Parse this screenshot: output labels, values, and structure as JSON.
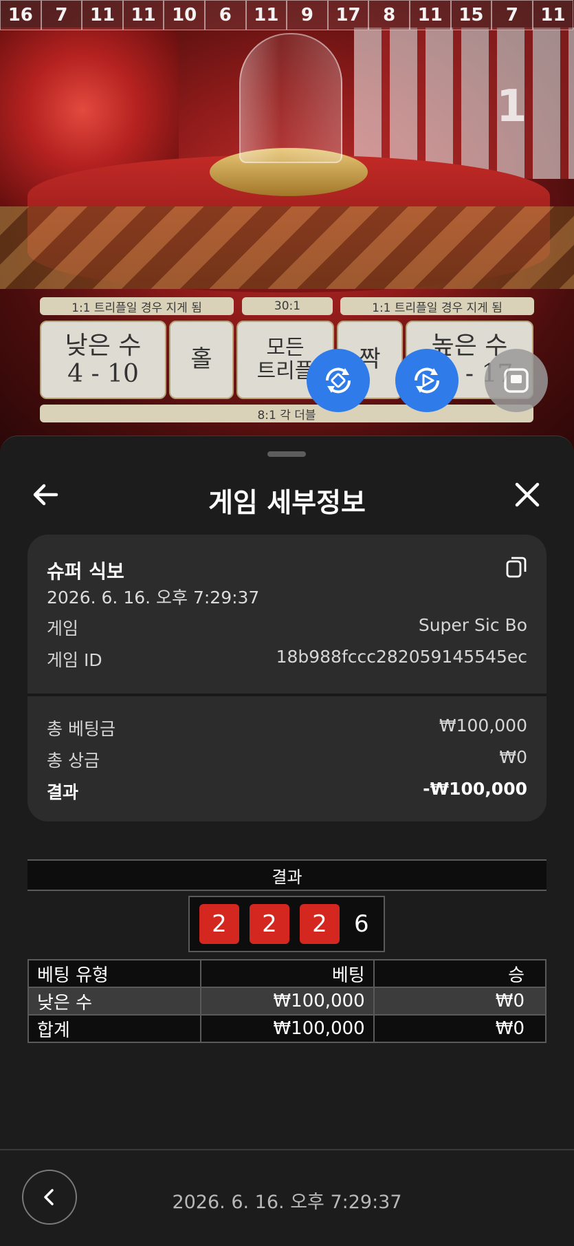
{
  "history": [
    "16",
    "7",
    "11",
    "11",
    "10",
    "6",
    "11",
    "9",
    "17",
    "8",
    "11",
    "15",
    "7",
    "11"
  ],
  "scene": {
    "round_number": "1"
  },
  "board": {
    "top_labels": [
      "1:1 트리플일 경우 지게 됨",
      "30:1",
      "1:1 트리플일 경우 지게 됨"
    ],
    "cells": [
      "낮은 수",
      "4 - 10",
      "홀",
      "모든",
      "트리플",
      "짝",
      "높은 수",
      "11 - 17"
    ],
    "bottom_label": "8:1 각 더블"
  },
  "sheet": {
    "title": "게임 세부정보",
    "game_name": "슈퍼 식보",
    "game_time": "2026. 6. 16. 오후 7:29:37",
    "rows": [
      {
        "label": "게임",
        "value": "Super Sic Bo"
      },
      {
        "label": "게임 ID",
        "value": "18b988fccc282059145545ec"
      }
    ],
    "totals": [
      {
        "label": "총 베팅금",
        "value": "₩100,000"
      },
      {
        "label": "총 상금",
        "value": "₩0"
      },
      {
        "label": "결과",
        "value": "-₩100,000"
      }
    ]
  },
  "results": {
    "header": "결과",
    "dice": [
      "2",
      "2",
      "2"
    ],
    "total": "6",
    "columns": [
      "베팅 유형",
      "베팅",
      "승"
    ],
    "rows": [
      {
        "type": "낮은 수",
        "bet": "₩100,000",
        "win": "₩0"
      },
      {
        "type": "합계",
        "bet": "₩100,000",
        "win": "₩0"
      }
    ]
  },
  "footer": {
    "time": "2026. 6. 16. 오후 7:29:37"
  },
  "colors": {
    "accent_blue": "#2f7bea",
    "die_red": "#d4271f",
    "sheet_bg": "#1c1c1c"
  },
  "icons": [
    "back-arrow-icon",
    "close-icon",
    "copy-icon",
    "rotate-icon",
    "replay-icon",
    "minimize-icon",
    "chevron-left-icon"
  ]
}
